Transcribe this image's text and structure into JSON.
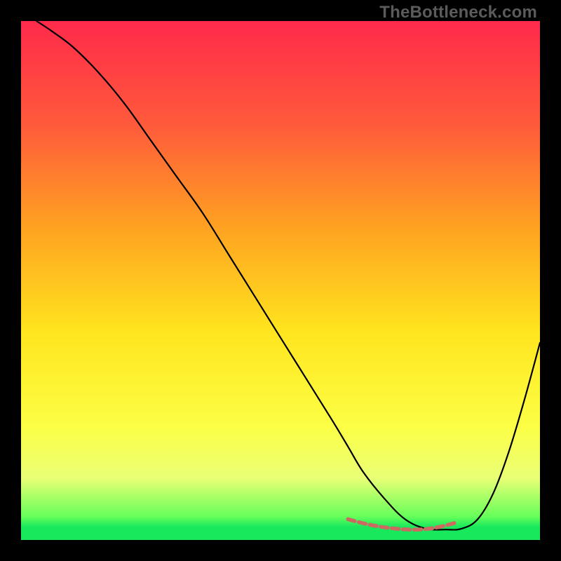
{
  "watermark": "TheBottleneck.com",
  "chart_data": {
    "type": "line",
    "title": "",
    "xlabel": "",
    "ylabel": "",
    "xlim": [
      0,
      100
    ],
    "ylim": [
      0,
      100
    ],
    "grid": false,
    "legend": false,
    "gradient_stops": [
      {
        "offset": 0.0,
        "color": "#ff2a4b"
      },
      {
        "offset": 0.2,
        "color": "#ff5a3b"
      },
      {
        "offset": 0.4,
        "color": "#ffa321"
      },
      {
        "offset": 0.6,
        "color": "#ffe51e"
      },
      {
        "offset": 0.78,
        "color": "#fcff45"
      },
      {
        "offset": 0.88,
        "color": "#eaff75"
      },
      {
        "offset": 0.955,
        "color": "#66ff5a"
      },
      {
        "offset": 0.975,
        "color": "#18e85c"
      },
      {
        "offset": 1.0,
        "color": "#18e85c"
      }
    ],
    "series": [
      {
        "name": "curve",
        "color": "#000000",
        "stroke_width": 2.2,
        "x": [
          3,
          6,
          10,
          15,
          20,
          25,
          30,
          35,
          40,
          45,
          50,
          55,
          60,
          63,
          66,
          70,
          74,
          78,
          82,
          85,
          88,
          91,
          94,
          97,
          100
        ],
        "values": [
          100,
          98,
          95,
          90,
          84,
          77,
          70,
          63,
          55,
          47,
          39,
          31,
          23,
          18,
          13,
          8,
          4,
          2.2,
          2.0,
          2.2,
          4,
          9,
          17,
          27,
          38
        ]
      },
      {
        "name": "flat-marker",
        "color": "#cc6a62",
        "stroke_width": 5.5,
        "dash": "10,6",
        "x": [
          63,
          66,
          69,
          72,
          75,
          78,
          81,
          84
        ],
        "values": [
          4,
          3.2,
          2.6,
          2.2,
          2.0,
          2.1,
          2.6,
          3.4
        ]
      }
    ],
    "annotations": []
  }
}
